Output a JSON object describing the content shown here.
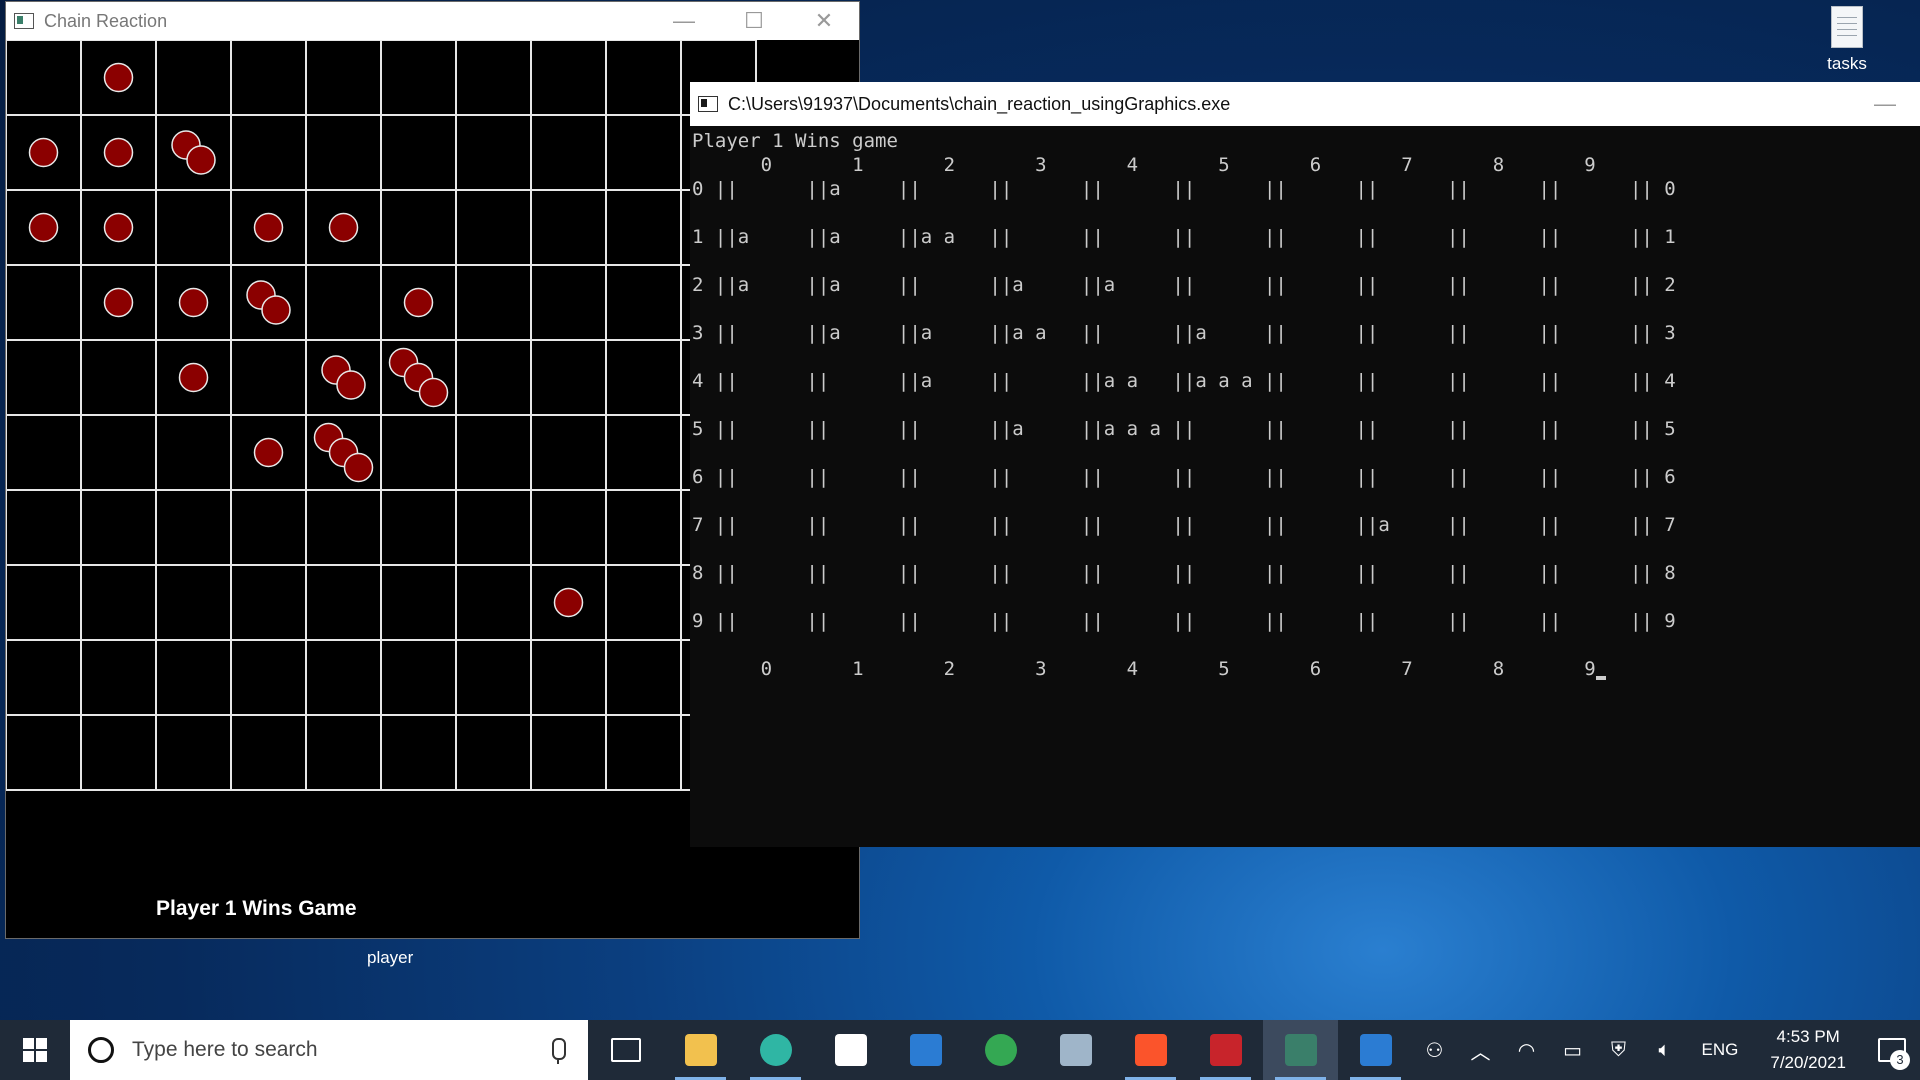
{
  "desktop": {
    "icon_label": "tasks",
    "stray_label": "player"
  },
  "chain_window": {
    "title": "Chain Reaction",
    "status": "Player 1 Wins Game",
    "orb_color": "#8b0000",
    "grid_color": "#e6e6e6",
    "board": {
      "rows": 10,
      "cols": 10,
      "cells": [
        {
          "row": 0,
          "col": 1,
          "count": 1
        },
        {
          "row": 1,
          "col": 0,
          "count": 1
        },
        {
          "row": 1,
          "col": 1,
          "count": 1
        },
        {
          "row": 1,
          "col": 2,
          "count": 2
        },
        {
          "row": 2,
          "col": 0,
          "count": 1
        },
        {
          "row": 2,
          "col": 1,
          "count": 1
        },
        {
          "row": 2,
          "col": 3,
          "count": 1
        },
        {
          "row": 2,
          "col": 4,
          "count": 1
        },
        {
          "row": 3,
          "col": 1,
          "count": 1
        },
        {
          "row": 3,
          "col": 2,
          "count": 1
        },
        {
          "row": 3,
          "col": 3,
          "count": 2
        },
        {
          "row": 3,
          "col": 5,
          "count": 1
        },
        {
          "row": 4,
          "col": 2,
          "count": 1
        },
        {
          "row": 4,
          "col": 4,
          "count": 2
        },
        {
          "row": 4,
          "col": 5,
          "count": 3
        },
        {
          "row": 5,
          "col": 3,
          "count": 1
        },
        {
          "row": 5,
          "col": 4,
          "count": 3
        },
        {
          "row": 7,
          "col": 7,
          "count": 1
        }
      ]
    }
  },
  "console_window": {
    "title": "C:\\Users\\91937\\Documents\\chain_reaction_usingGraphics.exe",
    "lines": [
      "Player 1 Wins game",
      "      0       1       2       3       4       5       6       7       8       9",
      "0 ||      ||a     ||      ||      ||      ||      ||      ||      ||      ||      || 0",
      "",
      "1 ||a     ||a     ||a a   ||      ||      ||      ||      ||      ||      ||      || 1",
      "",
      "2 ||a     ||a     ||      ||a     ||a     ||      ||      ||      ||      ||      || 2",
      "",
      "3 ||      ||a     ||a     ||a a   ||      ||a     ||      ||      ||      ||      || 3",
      "",
      "4 ||      ||      ||a     ||      ||a a   ||a a a ||      ||      ||      ||      || 4",
      "",
      "5 ||      ||      ||      ||a     ||a a a ||      ||      ||      ||      ||      || 5",
      "",
      "6 ||      ||      ||      ||      ||      ||      ||      ||      ||      ||      || 6",
      "",
      "7 ||      ||      ||      ||      ||      ||      ||      ||a     ||      ||      || 7",
      "",
      "8 ||      ||      ||      ||      ||      ||      ||      ||      ||      ||      || 8",
      "",
      "9 ||      ||      ||      ||      ||      ||      ||      ||      ||      ||      || 9",
      "",
      "      0       1       2       3       4       5       6       7       8       9"
    ]
  },
  "taskbar": {
    "search_placeholder": "Type here to search",
    "apps": [
      {
        "name": "task-view",
        "color": "#ffffff"
      },
      {
        "name": "file-explorer",
        "color": "#f2c14e"
      },
      {
        "name": "edge",
        "color": "#2fb6a4"
      },
      {
        "name": "store",
        "color": "#ffffff"
      },
      {
        "name": "mail",
        "color": "#2b7cd3"
      },
      {
        "name": "chrome",
        "color": "#34a853"
      },
      {
        "name": "app-generic",
        "color": "#9fb5c9"
      },
      {
        "name": "brave",
        "color": "#fb542b"
      },
      {
        "name": "winrar",
        "color": "#c8242b"
      },
      {
        "name": "chain-reaction",
        "color": "#3a7f6a"
      },
      {
        "name": "console",
        "color": "#2b7cd3"
      }
    ],
    "language": "ENG",
    "time": "4:53 PM",
    "date": "7/20/2021",
    "notification_count": "3"
  }
}
